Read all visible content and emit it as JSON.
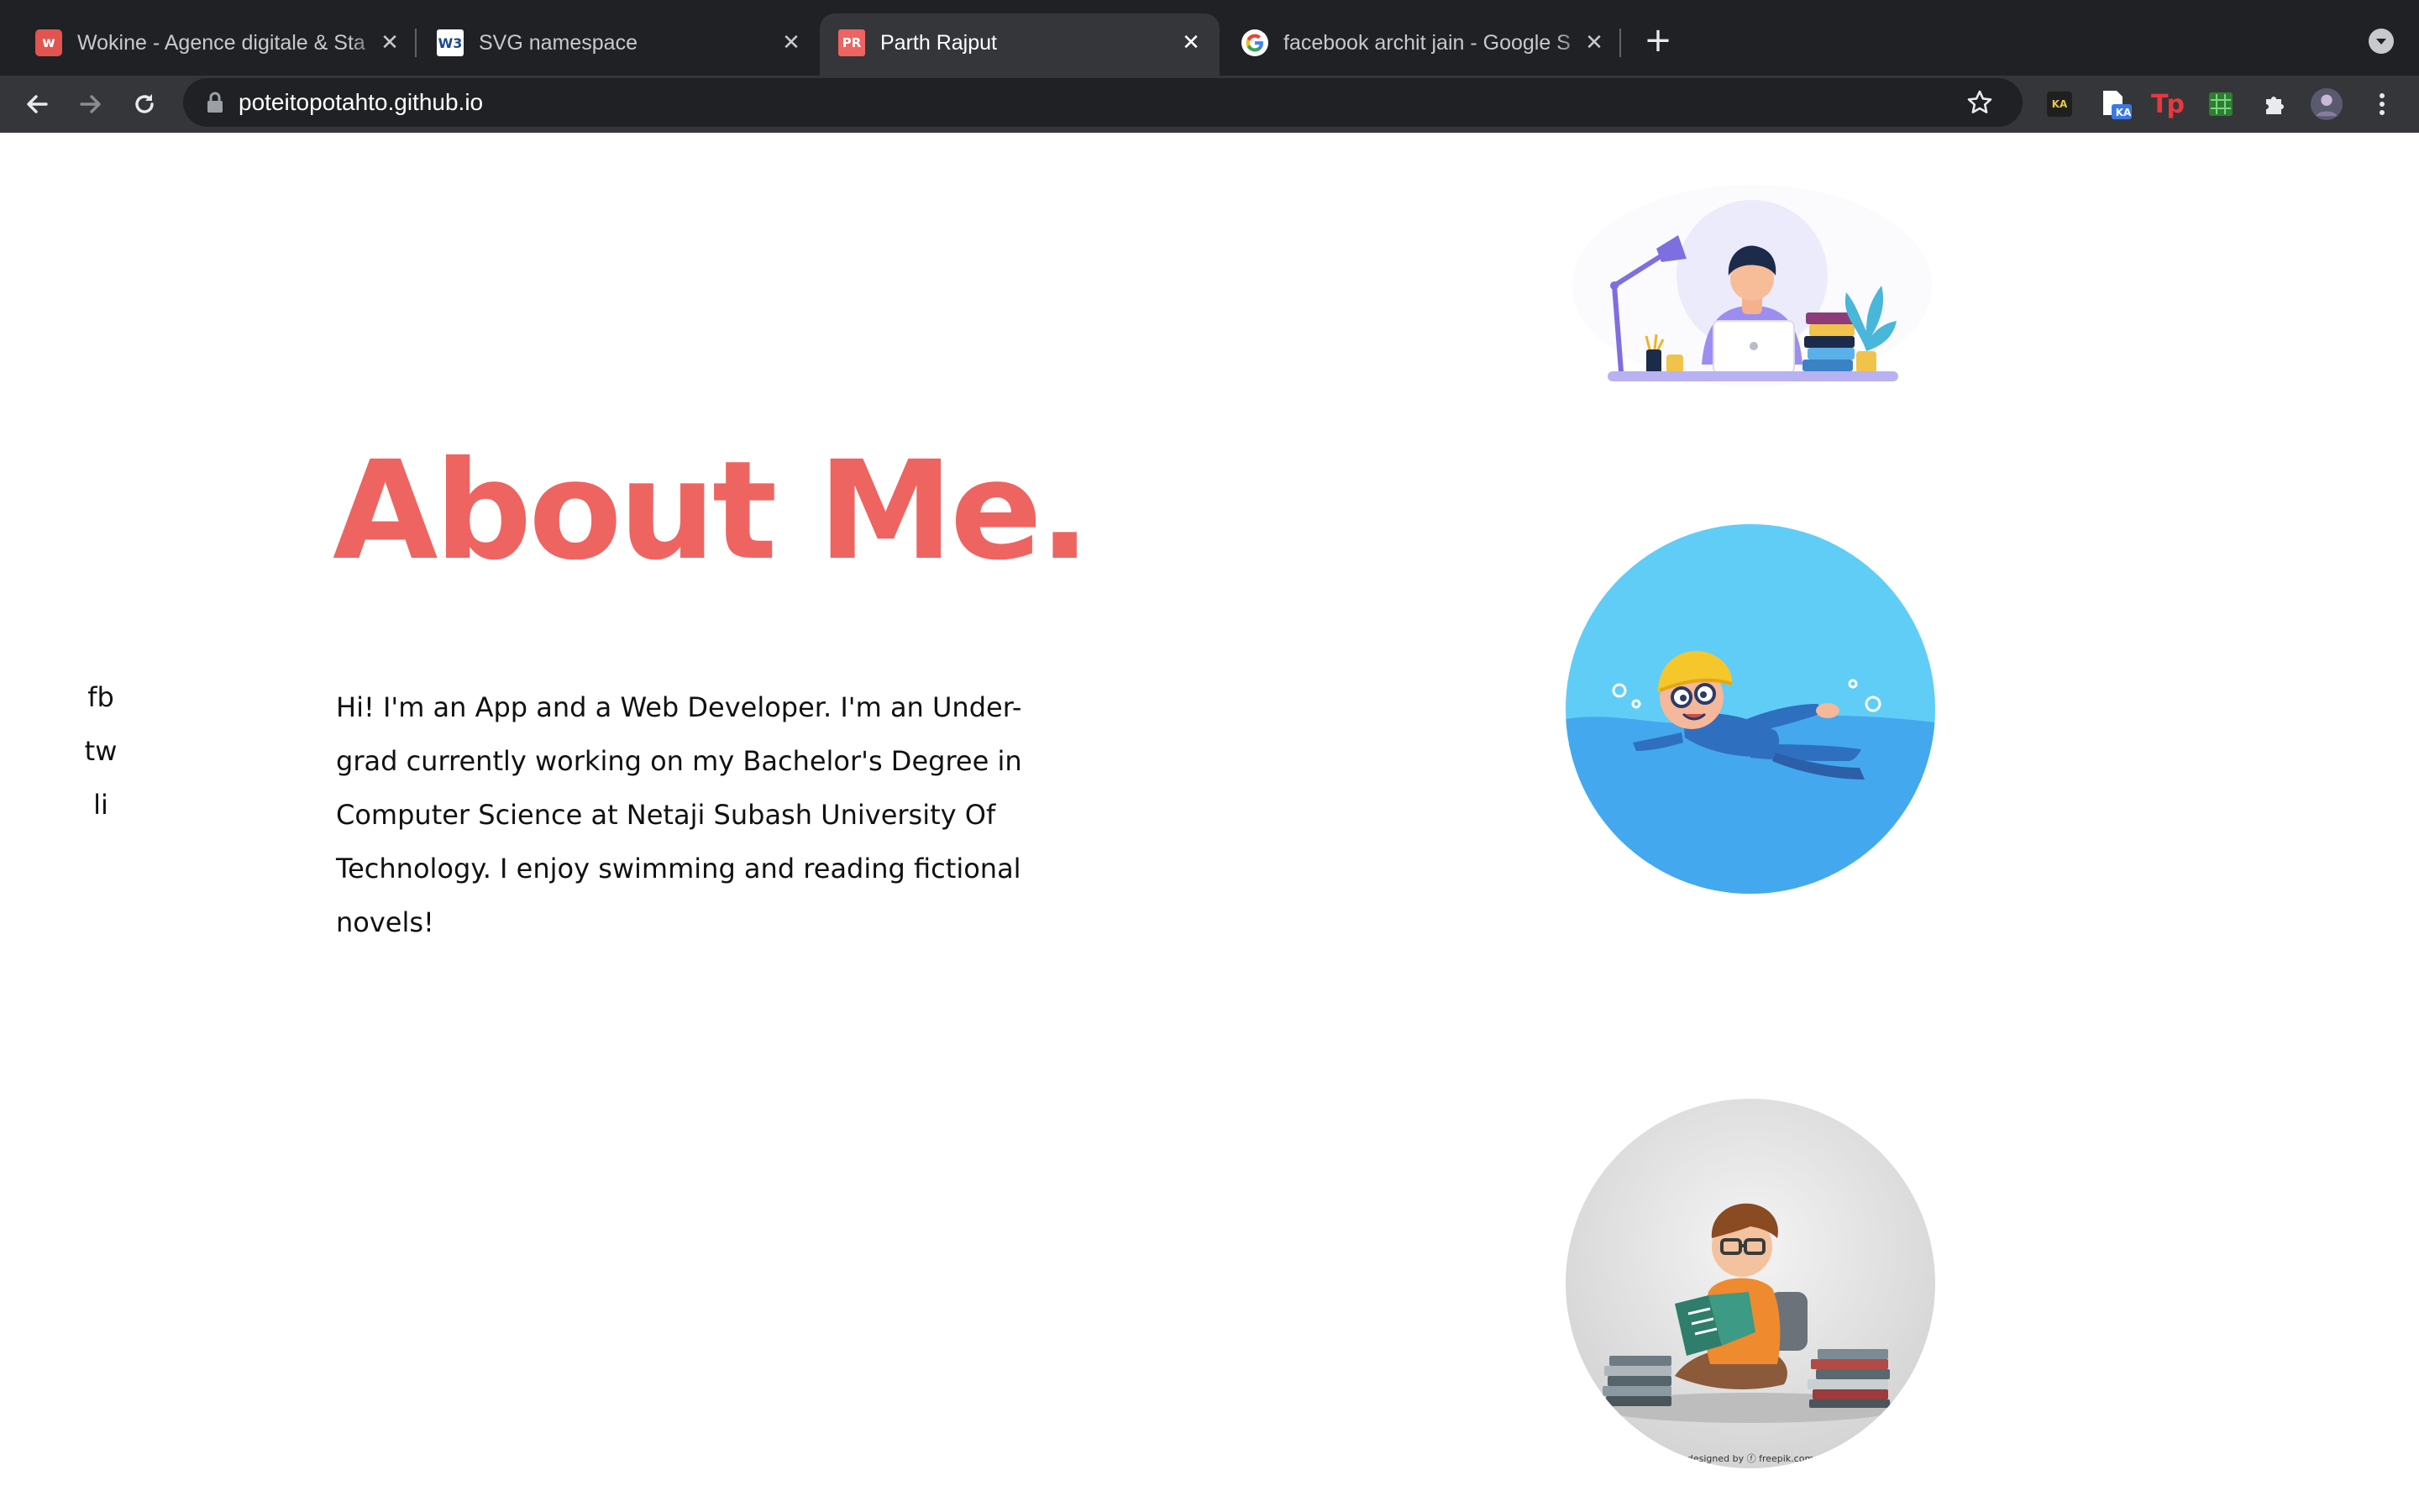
{
  "browser": {
    "tabs": [
      {
        "title": "Wokine - Agence digitale & Sta",
        "favicon": "wokine-icon",
        "active": false
      },
      {
        "title": "SVG namespace",
        "favicon": "w3c-icon",
        "active": false
      },
      {
        "title": "Parth Rajput",
        "favicon": "pr-icon",
        "active": true
      },
      {
        "title": "facebook archit jain - Google S",
        "favicon": "google-icon",
        "active": false
      }
    ],
    "favicon_labels": {
      "wokine": "w",
      "w3c": "W3",
      "pr": "PR"
    },
    "new_tab_label": "+",
    "url": "poteitopotahto.github.io",
    "extension_labels": {
      "ka": "KA",
      "tp": "Tp"
    },
    "colors": {
      "tabbar": "#202124",
      "toolbar": "#35363a",
      "active_tab": "#35363a"
    }
  },
  "page": {
    "social_links": [
      "fb",
      "tw",
      "li"
    ],
    "heading": "About Me.",
    "about_text": "Hi! I'm an App and a Web Developer. I'm an Under-grad currently working on my Bachelor's Degree in Computer Science at Netaji Subash University Of Technology. I enjoy swimming and reading fictional novels!",
    "credit_text": "designed by ⓕ freepik.com",
    "colors": {
      "accent": "#ee6461",
      "text": "#111111",
      "background": "#ffffff"
    },
    "illustrations": [
      "developer-at-desk-illustration",
      "swimmer-illustration",
      "reader-with-books-illustration"
    ]
  }
}
